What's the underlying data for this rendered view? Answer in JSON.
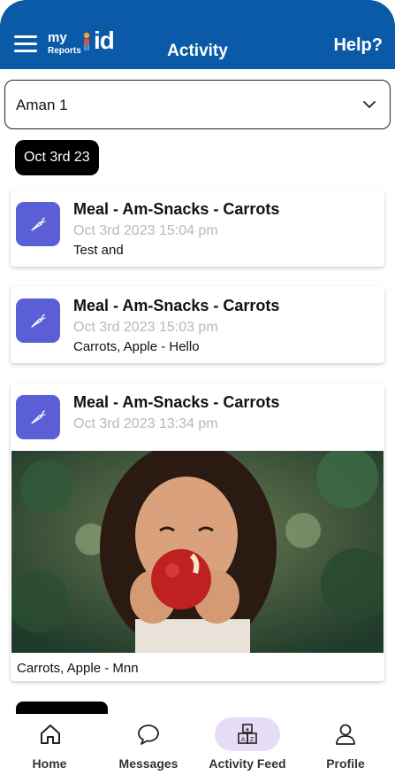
{
  "header": {
    "logo_my": "my",
    "logo_reports": "Reports",
    "logo_id": "id",
    "title": "Activity",
    "help_label": "Help?"
  },
  "child_select": {
    "value": "Aman 1",
    "icon": "chevron-down-icon"
  },
  "date_chip": {
    "label": "Oct 3rd 23"
  },
  "feed": [
    {
      "icon": "carrot-icon",
      "title": "Meal - Am-Snacks - Carrots",
      "time": "Oct 3rd 2023 15:04 pm",
      "note": "Test and"
    },
    {
      "icon": "carrot-icon",
      "title": "Meal - Am-Snacks - Carrots",
      "time": "Oct 3rd 2023 15:03 pm",
      "note": "Carrots, Apple - Hello"
    },
    {
      "icon": "carrot-icon",
      "title": "Meal - Am-Snacks - Carrots",
      "time": "Oct 3rd 2023 13:34 pm",
      "photo": "child-eating-apple-photo",
      "caption": "Carrots, Apple - Mnn"
    }
  ],
  "bottom_nav": {
    "items": [
      {
        "label": "Home",
        "icon": "home-icon"
      },
      {
        "label": "Messages",
        "icon": "chat-bubble-icon"
      },
      {
        "label": "Activity Feed",
        "icon": "abc-blocks-icon",
        "active": true
      },
      {
        "label": "Profile",
        "icon": "user-icon"
      }
    ]
  },
  "colors": {
    "header_bg": "#0b5aa8",
    "activity_icon_bg": "#5b5fd6",
    "active_tab_pill": "#e6dcf5",
    "timestamp_text": "#b8b8b8"
  }
}
